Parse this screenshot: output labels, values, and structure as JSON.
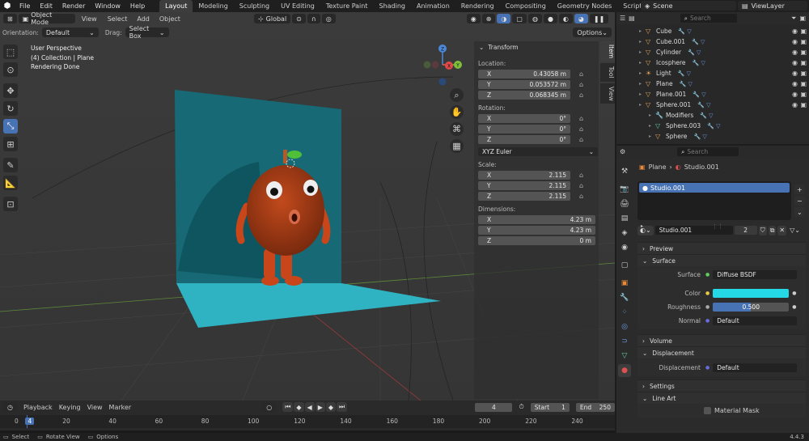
{
  "menubar": {
    "items": [
      "File",
      "Edit",
      "Render",
      "Window",
      "Help"
    ],
    "workspaces": [
      "Layout",
      "Modeling",
      "Sculpting",
      "UV Editing",
      "Texture Paint",
      "Shading",
      "Animation",
      "Rendering",
      "Compositing",
      "Geometry Nodes",
      "Scripting"
    ],
    "add_tab": "+",
    "scene": "Scene",
    "view_layer": "ViewLayer"
  },
  "viewport_header": {
    "mode": "Object Mode",
    "view": "View",
    "select": "Select",
    "add": "Add",
    "object": "Object",
    "orientation_select": "Global"
  },
  "tool_settings": {
    "orientation_label": "Orientation:",
    "orientation_value": "Default",
    "drag_label": "Drag:",
    "drag_value": "Select Box",
    "options": "Options"
  },
  "overlay_text": {
    "line1": "User Perspective",
    "line2": "(4) Collection | Plane",
    "line3": "Rendering Done"
  },
  "gizmo": {
    "x": "X",
    "y": "Y",
    "z": "Z"
  },
  "n_panel": {
    "tabs": [
      "Item",
      "Tool",
      "View"
    ],
    "title": "Transform",
    "location_label": "Location:",
    "location": [
      {
        "axis": "X",
        "value": "0.43058 m"
      },
      {
        "axis": "Y",
        "value": "0.053572 m"
      },
      {
        "axis": "Z",
        "value": "0.068345 m"
      }
    ],
    "rotation_label": "Rotation:",
    "rotation": [
      {
        "axis": "X",
        "value": "0°"
      },
      {
        "axis": "Y",
        "value": "0°"
      },
      {
        "axis": "Z",
        "value": "0°"
      }
    ],
    "rotation_mode": "XYZ Euler",
    "scale_label": "Scale:",
    "scale": [
      {
        "axis": "X",
        "value": "2.115"
      },
      {
        "axis": "Y",
        "value": "2.115"
      },
      {
        "axis": "Z",
        "value": "2.115"
      }
    ],
    "dimensions_label": "Dimensions:",
    "dimensions": [
      {
        "axis": "X",
        "value": "4.23 m"
      },
      {
        "axis": "Y",
        "value": "4.23 m"
      },
      {
        "axis": "Z",
        "value": "0 m"
      }
    ]
  },
  "timeline": {
    "playback": "Playback",
    "keying": "Keying",
    "view": "View",
    "marker": "Marker",
    "current_frame": "4",
    "start_label": "Start",
    "start": "1",
    "end_label": "End",
    "end": "250",
    "ruler": [
      "0",
      "4",
      "20",
      "40",
      "60",
      "80",
      "100",
      "120",
      "140",
      "160",
      "180",
      "200",
      "220",
      "240"
    ]
  },
  "statusbar": {
    "select": "Select",
    "rotate": "Rotate View",
    "options": "Options",
    "version": "4.4.3"
  },
  "outliner": {
    "search_placeholder": "Search",
    "rows": [
      {
        "name": "Cube",
        "indent": 0,
        "icon": "▽",
        "color": "#e3a55a"
      },
      {
        "name": "Cube.001",
        "indent": 0,
        "icon": "▽",
        "color": "#e3a55a"
      },
      {
        "name": "Cylinder",
        "indent": 0,
        "icon": "▽",
        "color": "#e3a55a"
      },
      {
        "name": "Icosphere",
        "indent": 0,
        "icon": "▽",
        "color": "#e3a55a"
      },
      {
        "name": "Light",
        "indent": 0,
        "icon": "☀",
        "color": "#e3a55a"
      },
      {
        "name": "Plane",
        "indent": 0,
        "icon": "▽",
        "color": "#e3a55a"
      },
      {
        "name": "Plane.001",
        "indent": 0,
        "icon": "▽",
        "color": "#e3a55a"
      },
      {
        "name": "Sphere.001",
        "indent": 0,
        "icon": "▽",
        "color": "#e3a55a"
      },
      {
        "name": "Modifiers",
        "indent": 1,
        "icon": "🔧",
        "color": "#7fa7e0"
      },
      {
        "name": "Sphere.003",
        "indent": 1,
        "icon": "▽",
        "color": "#5fcf9e"
      },
      {
        "name": "Sphere",
        "indent": 1,
        "icon": "▽",
        "color": "#e3a55a"
      }
    ]
  },
  "properties": {
    "search_placeholder": "Search",
    "breadcrumb_object": "Plane",
    "breadcrumb_material": "Studio.001",
    "material_slot": "Studio.001",
    "material_name": "Studio.001",
    "users": "2",
    "preview": "Preview",
    "surface_panel": "Surface",
    "surface_label": "Surface",
    "surface_value": "Diffuse BSDF",
    "color_label": "Color",
    "color_hex": "#24d8e6",
    "roughness_label": "Roughness",
    "roughness_value": "0.500",
    "roughness_fraction": 0.5,
    "normal_label": "Normal",
    "normal_value": "Default",
    "volume": "Volume",
    "displacement_panel": "Displacement",
    "displacement_label": "Displacement",
    "displacement_value": "Default",
    "settings": "Settings",
    "line_art": "Line Art",
    "material_mask": "Material Mask"
  }
}
